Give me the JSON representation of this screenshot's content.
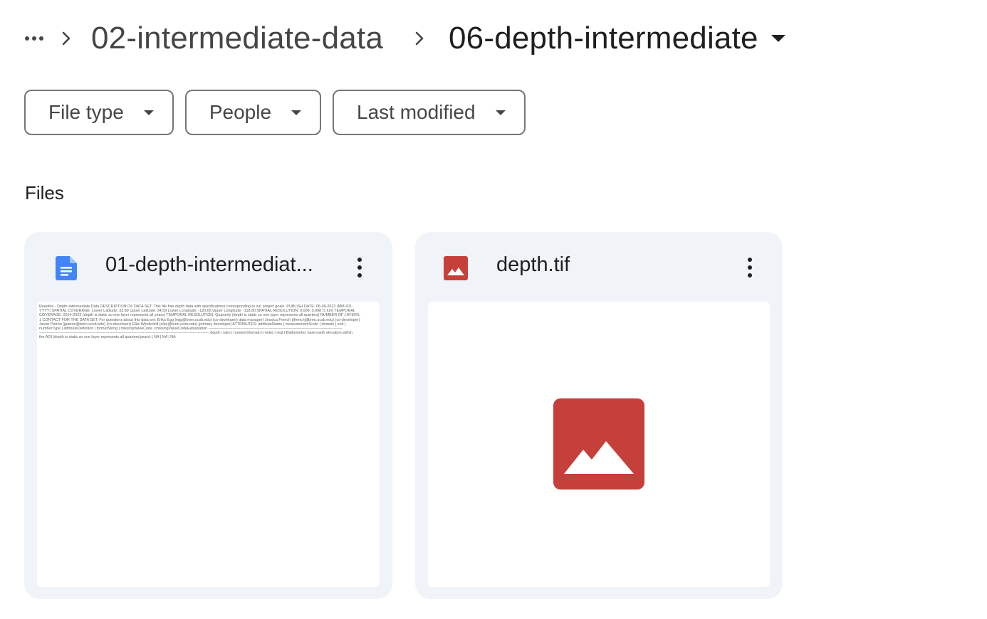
{
  "breadcrumb": {
    "more_icon": "more-horiz-icon",
    "separator_icon": "chevron-right-icon",
    "parent": "02-intermediate-data",
    "current": "06-depth-intermediate"
  },
  "filters": [
    {
      "label": "File type"
    },
    {
      "label": "People"
    },
    {
      "label": "Last modified"
    }
  ],
  "section": {
    "files_label": "Files"
  },
  "files": [
    {
      "title": "01-depth-intermediat...",
      "icon": "google-docs-icon",
      "icon_color": "#4285f4",
      "preview_lines": [
        "Readme - Depth-Intermediate Data DESCRIPTION OF DATA SET: This file has depth data with specifications corresponding to our project goals. PUBLISH DATE: 06-09-2023 (MM-DD-",
        "YYYY) SPATIAL COVERAGE: Lower Latitude: 33.89 Upper Latitude: 34.59 Lower Longitude: -120.65 Upper Longitude: -118.80 SPATIAL RESOLUTION: 0.008, 0.008 (1 km) TEMPORAL",
        "COVERAGE: 2014-2022 (depth is static so one layer represents all years) TEMPORAL RESOLUTION: Quarterly (depth is static so one layer represents all quarters) NUMBER OF LAYERS:",
        "1 CONTACT FOR THE DATA SET: For questions about this data set: Erika Egg (egg@bren.ucsb.edu) (co-developer) data manager) Jessica French (jfrench@bren.ucsb.edu) (co-developer)",
        "Javier Patrón (jpatron@bren.ucsb.edu) (co-developer) Elke Windschitl (elke@bren.ucsb.edu) (primary developer) ATTRIBUTES: attributeName | measurementScale | domain | unit |",
        "numberType | attributeDefinition | formatString | missingValueCode | missingValueCodeExplanation ---------------------------------------------------------------------------------------------------------",
        "------------------------------------------------------------------------------------------------------------------------------------- depth | ratio | numericDomain | meter | real | Bathymetric bare-earth elevation within",
        "the AOI (depth is static so one layer represents all quarters/years) | NA | NA | NA"
      ]
    },
    {
      "title": "depth.tif",
      "icon": "image-file-icon",
      "icon_color": "#c5403a",
      "preview_icon": "image-placeholder-icon"
    }
  ],
  "card_menu_icon": "more-vert-icon"
}
